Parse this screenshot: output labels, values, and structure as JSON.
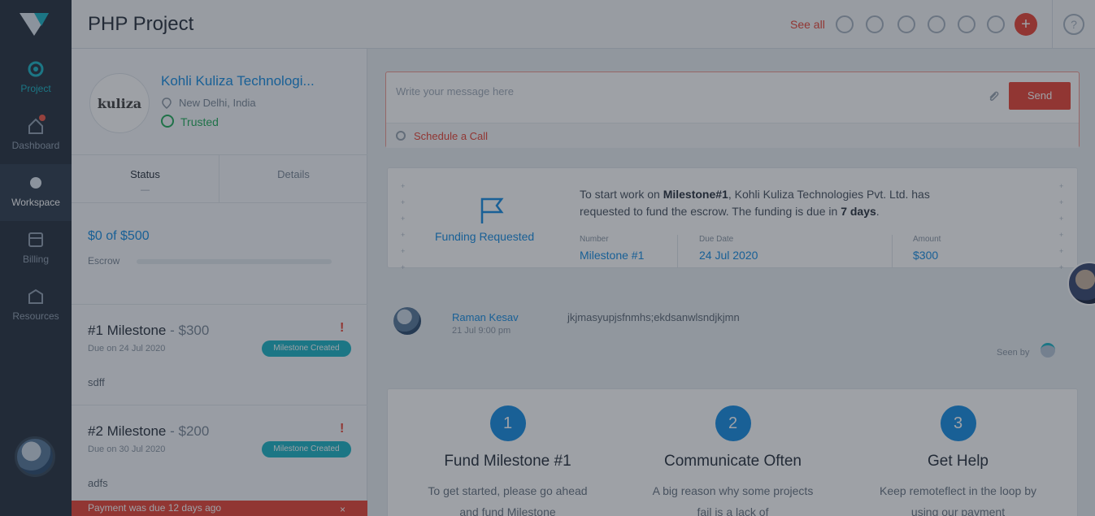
{
  "header": {
    "title": "PHP Project",
    "see_all": "See all",
    "help": "?",
    "add": "+"
  },
  "sidebar": {
    "items": [
      {
        "label": "Project",
        "icon": "project-icon"
      },
      {
        "label": "Dashboard",
        "icon": "home-icon"
      },
      {
        "label": "Workspace",
        "icon": "workspace-icon"
      },
      {
        "label": "Billing",
        "icon": "billing-icon"
      },
      {
        "label": "Resources",
        "icon": "resources-icon"
      }
    ]
  },
  "company": {
    "logo_text": "kulizа",
    "name": "Kohli Kuliza Technologi...",
    "location": "New Delhi, India",
    "status": "Trusted"
  },
  "tabs": [
    {
      "label": "Status",
      "sub": "—"
    },
    {
      "label": "Details",
      "sub": ""
    }
  ],
  "escrow": {
    "funds_text": "$0 of $500",
    "label": "Escrow",
    "fraction": 0
  },
  "milestones": [
    {
      "title": "#1 Milestone",
      "amount": "- $300",
      "due": "Due on 24 Jul 2020",
      "badge": "Milestone Created",
      "desc": "sdff"
    },
    {
      "title": "#2 Milestone",
      "amount": "- $200",
      "due": "Due on 30 Jul 2020",
      "badge": "Milestone Created",
      "desc": "adfs"
    }
  ],
  "overdue": {
    "text": "Payment was due 12 days ago",
    "close": "×"
  },
  "composer": {
    "placeholder": "Write your message here",
    "send": "Send",
    "schedule": "Schedule a Call"
  },
  "funding": {
    "title": "Funding Requested",
    "text_prefix": "To start work on ",
    "text_milestone": "Milestone#1",
    "text_middle": ", Kohli Kuliza Technologies Pvt. Ltd. has requested to fund the escrow. The funding is due in ",
    "text_days": "7 days",
    "text_end": ".",
    "fields": [
      {
        "key": "Number",
        "value": "Milestone #1"
      },
      {
        "key": "Due Date",
        "value": "24 Jul 2020"
      },
      {
        "key": "Amount",
        "value": "$300"
      }
    ]
  },
  "chat": {
    "name": "Raman Kesav",
    "time": "21 Jul 9:00 pm",
    "message": "jkjmasyupjsfnmhs;ekdsanwlsndjkjmn",
    "seen": "Seen by"
  },
  "steps": [
    {
      "num": "1",
      "title": "Fund Milestone #1",
      "desc": "To get started, please go ahead and fund Milestone"
    },
    {
      "num": "2",
      "title": "Communicate Often",
      "desc": "A big reason why some projects fail is a lack of"
    },
    {
      "num": "3",
      "title": "Get Help",
      "desc": "Keep remoteflect in the loop by using our payment"
    }
  ],
  "colors": {
    "accent": "#1fb6c6",
    "link": "#1a8fe3",
    "danger": "#e8483a",
    "sidebar": "#2a3542"
  }
}
